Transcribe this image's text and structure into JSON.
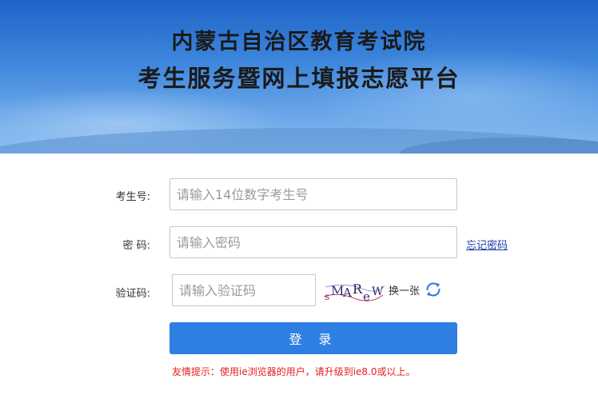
{
  "header": {
    "title_line1": "内蒙古自治区教育考试院",
    "title_line2": "考生服务暨网上填报志愿平台"
  },
  "form": {
    "exam_number": {
      "label": "考生号:",
      "placeholder": "请输入14位数字考生号",
      "value": ""
    },
    "password": {
      "label": "密 码:",
      "placeholder": "请输入密码",
      "value": "",
      "forgot_link": "忘记密码"
    },
    "captcha": {
      "label": "验证码:",
      "placeholder": "请输入验证码",
      "value": "",
      "image_text": "sMAReW",
      "refresh_label": "换一张"
    },
    "login_button": "登 录",
    "notice": "友情提示：使用ie浏览器的用户，请升级到ie8.0或以上。"
  },
  "colors": {
    "banner_top": "#1e64c8",
    "primary_button": "#2f7fe3",
    "notice_text": "#e02020",
    "link": "#1a3fa8"
  },
  "icons": {
    "refresh": "refresh-icon"
  }
}
